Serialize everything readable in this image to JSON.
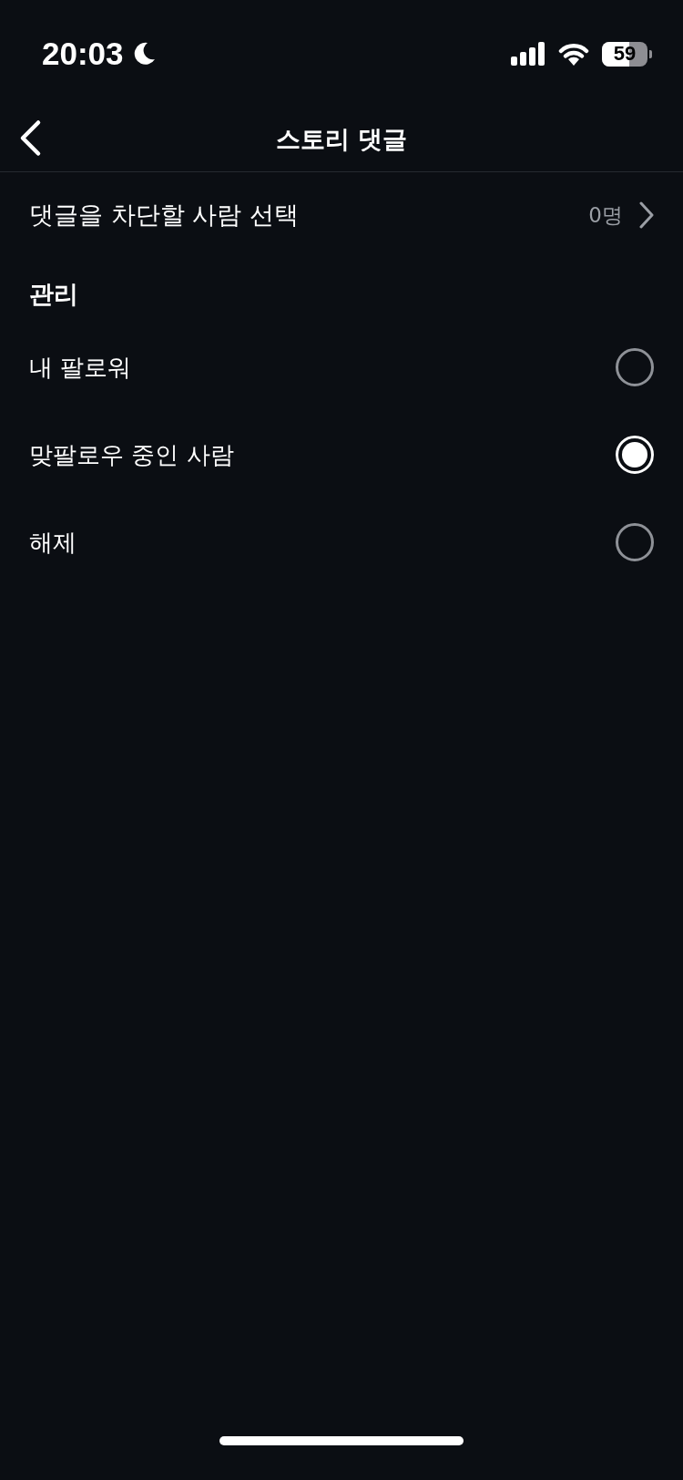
{
  "status_bar": {
    "time": "20:03",
    "battery": "59"
  },
  "header": {
    "title": "스토리 댓글"
  },
  "block_row": {
    "label": "댓글을 차단할 사람 선택",
    "value": "0명"
  },
  "section": {
    "title": "관리"
  },
  "options": [
    {
      "label": "내 팔로워",
      "selected": false
    },
    {
      "label": "맞팔로우 중인 사람",
      "selected": true
    },
    {
      "label": "해제",
      "selected": false
    }
  ]
}
